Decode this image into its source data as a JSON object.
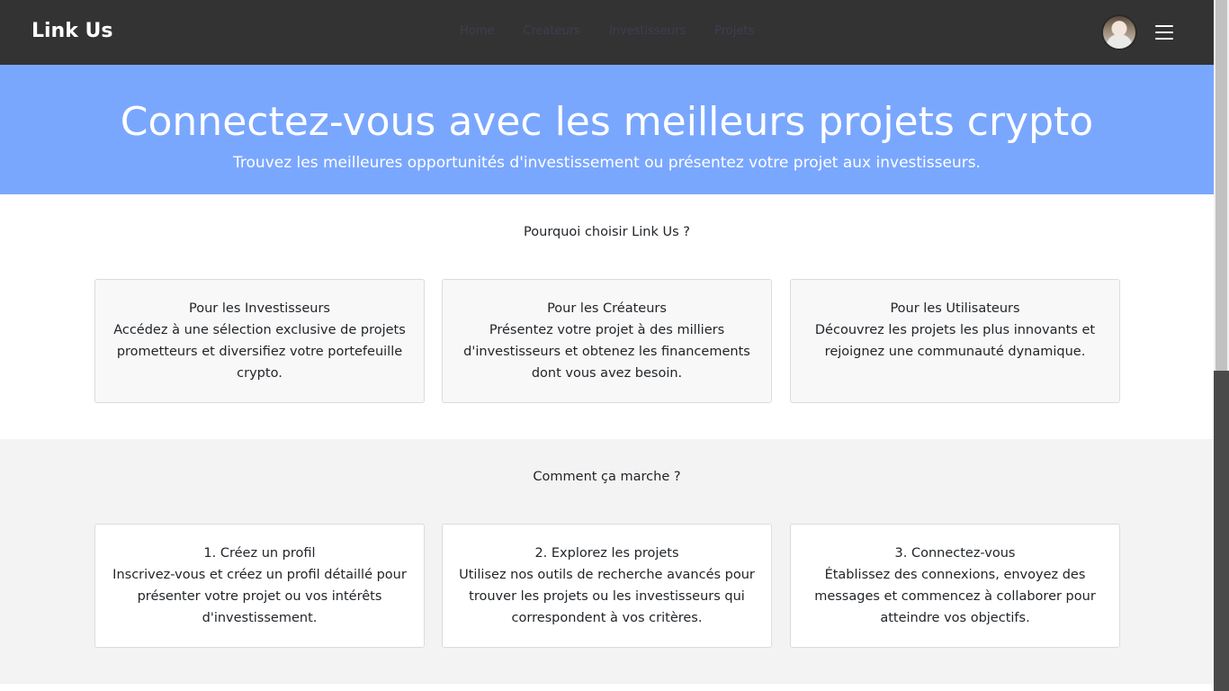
{
  "navbar": {
    "brand": "Link Us",
    "links": [
      "Home",
      "Createurs",
      "Investisseurs",
      "Projets"
    ]
  },
  "hero": {
    "title": "Connectez-vous avec les meilleurs projets crypto",
    "subtitle": "Trouvez les meilleures opportunités d'investissement ou présentez votre projet aux investisseurs."
  },
  "why": {
    "title": "Pourquoi choisir Link Us ?",
    "cards": [
      {
        "heading": "Pour les Investisseurs",
        "text": "Accédez à une sélection exclusive de projets prometteurs et diversifiez votre portefeuille crypto."
      },
      {
        "heading": "Pour les Créateurs",
        "text": "Présentez votre projet à des milliers d'investisseurs et obtenez les financements dont vous avez besoin."
      },
      {
        "heading": "Pour les Utilisateurs",
        "text": "Découvrez les projets les plus innovants et rejoignez une communauté dynamique."
      }
    ]
  },
  "how": {
    "title": "Comment ça marche ?",
    "cards": [
      {
        "heading": "1. Créez un profil",
        "text": "Inscrivez-vous et créez un profil détaillé pour présenter votre projet ou vos intérêts d'investissement."
      },
      {
        "heading": "2. Explorez les projets",
        "text": "Utilisez nos outils de recherche avancés pour trouver les projets ou les investisseurs qui correspondent à vos critères."
      },
      {
        "heading": "3. Connectez-vous",
        "text": "Établissez des connexions, envoyez des messages et commencez à collaborer pour atteindre vos objectifs."
      }
    ]
  },
  "colors": {
    "navbar_bg": "#343333",
    "hero_bg": "#7aa7fe",
    "section_grey_bg": "#f3f3f3"
  }
}
